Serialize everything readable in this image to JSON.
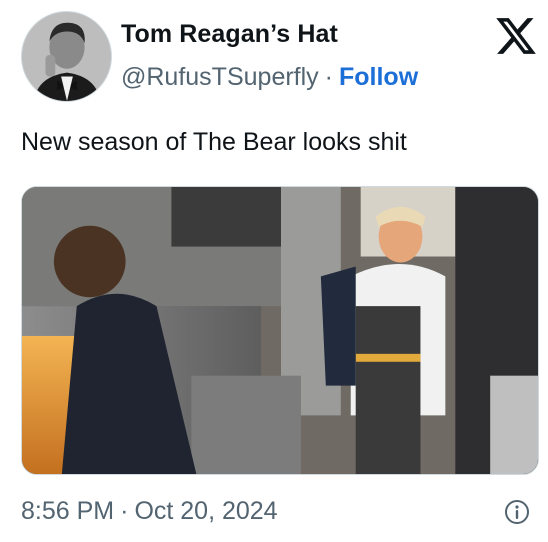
{
  "author": {
    "display_name": "Tom Reagan’s Hat",
    "handle": "@RufusTSuperfly",
    "separator": "·",
    "follow_label": "Follow",
    "avatar_icon": "avatar-portrait"
  },
  "brand": {
    "logo_icon": "x-logo-icon"
  },
  "tweet": {
    "text": "New season of The Bear looks shit",
    "media_icon": "photo"
  },
  "meta": {
    "time": "8:56 PM",
    "separator": "·",
    "date": "Oct 20, 2024",
    "info_icon": "info-icon"
  },
  "colors": {
    "follow": "#1d6fd8",
    "secondary_text": "#536471",
    "primary_text": "#0f1419"
  }
}
